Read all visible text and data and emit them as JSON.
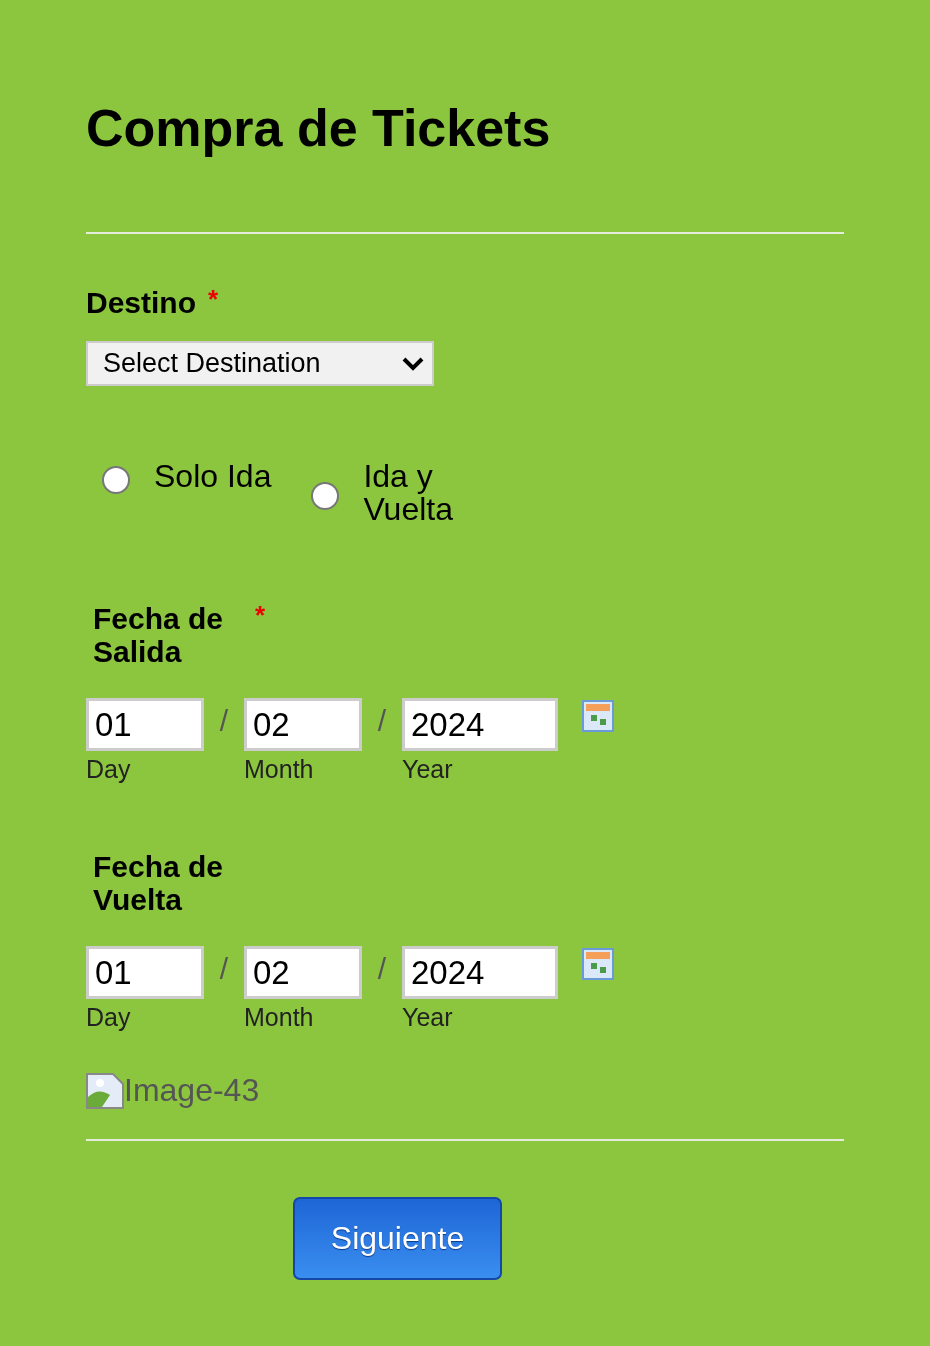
{
  "title": "Compra de Tickets",
  "fields": [
    {
      "kind": "select",
      "label": "Destino",
      "required_mark": "*",
      "placeholder": "Select Destination"
    },
    {
      "kind": "radio",
      "options": [
        {
          "label": "Solo Ida",
          "selected": false
        },
        {
          "label": "Ida y Vuelta",
          "selected": false
        }
      ]
    },
    {
      "kind": "date",
      "label": "Fecha de Salida",
      "required_mark": "*",
      "separator": "/",
      "parts": [
        {
          "value": "01",
          "sublabel": "Day"
        },
        {
          "value": "02",
          "sublabel": "Month"
        },
        {
          "value": "2024",
          "sublabel": "Year"
        }
      ]
    },
    {
      "kind": "date",
      "label": "Fecha de Vuelta",
      "separator": "/",
      "parts": [
        {
          "value": "01",
          "sublabel": "Day"
        },
        {
          "value": "02",
          "sublabel": "Month"
        },
        {
          "value": "2024",
          "sublabel": "Year"
        }
      ]
    },
    {
      "kind": "image",
      "alt": "Image-43"
    }
  ],
  "button": "Siguiente"
}
